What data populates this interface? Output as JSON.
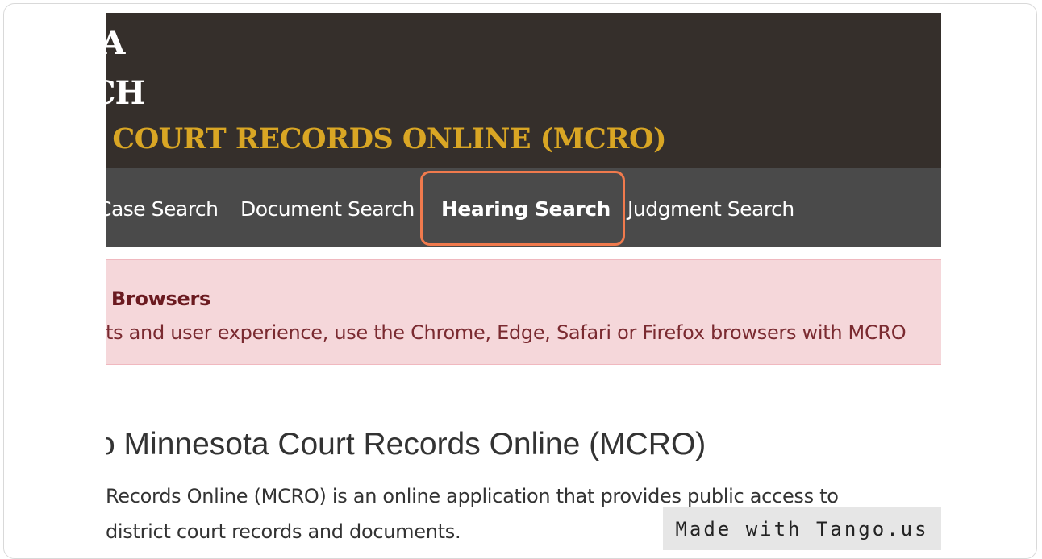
{
  "header": {
    "line1": "OTA",
    "line2": "L BRANCH",
    "line3": "A COURT RECORDS ONLINE (MCRO)"
  },
  "nav": {
    "case_search": "Case Search",
    "document_search": "Document Search",
    "hearing_search": "Hearing Search",
    "judgment_search": "Judgment Search"
  },
  "alert": {
    "title": "ed Browsers",
    "text": "ts and user experience, use the Chrome, Edge, Safari or Firefox browsers with MCRO"
  },
  "main": {
    "welcome": "Minnesota Court Records Online (MCRO)",
    "welcome_prefix": "o",
    "para_line1": "Records Online (MCRO) is an online application that provides public access to",
    "para_line2": "district court records and documents."
  },
  "watermark": "Made with Tango.us",
  "colors": {
    "header_bg": "#352f2b",
    "gold": "#d9a624",
    "nav_bg": "#4a4a4a",
    "highlight": "#f07a4d",
    "alert_bg": "#f5d7da"
  }
}
